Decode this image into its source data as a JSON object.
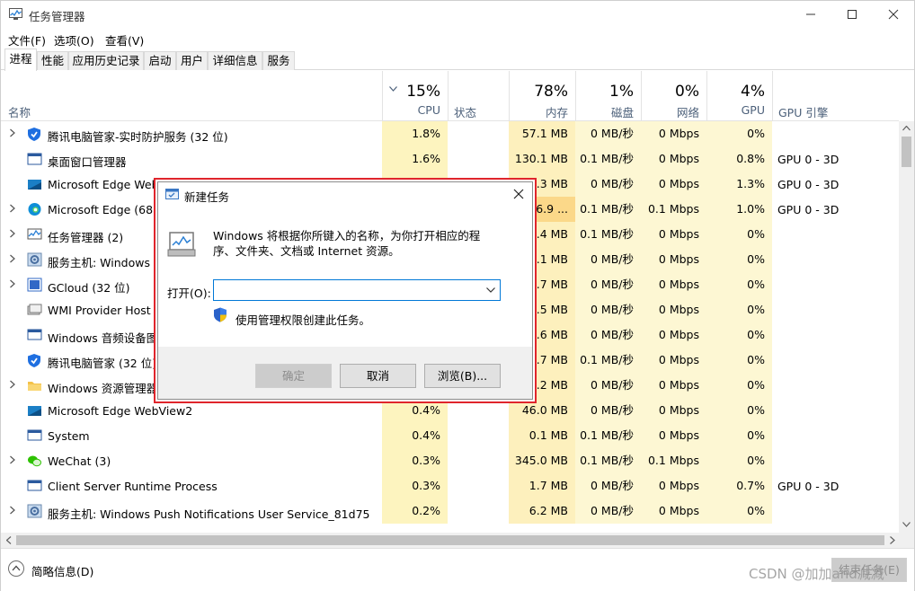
{
  "window": {
    "title": "任务管理器"
  },
  "menu": [
    "文件(F)",
    "选项(O)",
    "查看(V)"
  ],
  "tabs": [
    "进程",
    "性能",
    "应用历史记录",
    "启动",
    "用户",
    "详细信息",
    "服务"
  ],
  "columns": {
    "name": "名称",
    "cpu": {
      "pct": "15%",
      "label": "CPU"
    },
    "status": "状态",
    "memory": {
      "pct": "78%",
      "label": "内存"
    },
    "disk": {
      "pct": "1%",
      "label": "磁盘"
    },
    "network": {
      "pct": "0%",
      "label": "网络"
    },
    "gpu": {
      "pct": "4%",
      "label": "GPU"
    },
    "gpu_engine": "GPU 引擎"
  },
  "rows": [
    {
      "icon": "tencent-shield-icon",
      "name": "腾讯电脑管家-实时防护服务 (32 位)",
      "cpu": "1.8%",
      "mem": "57.1 MB",
      "disk": "0 MB/秒",
      "net": "0 Mbps",
      "gpu": "0%",
      "gpu_engine": ""
    },
    {
      "icon": "desktop-window-icon",
      "name": "桌面窗口管理器",
      "cpu": "1.6%",
      "mem": "130.1 MB",
      "disk": "0.1 MB/秒",
      "net": "0 Mbps",
      "gpu": "0.8%",
      "gpu_engine": "GPU 0 - 3D"
    },
    {
      "icon": "edge-webview-icon",
      "name": "Microsoft Edge WebView2",
      "cpu": "",
      "mem": "36.3 MB",
      "disk": "0 MB/秒",
      "net": "0 Mbps",
      "gpu": "1.3%",
      "gpu_engine": "GPU 0 - 3D"
    },
    {
      "icon": "edge-icon",
      "name": "Microsoft Edge (68)",
      "cpu": "",
      "mem": "1,036.9 ...",
      "disk": "0.1 MB/秒",
      "net": "0.1 Mbps",
      "gpu": "1.0%",
      "gpu_engine": "GPU 0 - 3D"
    },
    {
      "icon": "task-manager-icon",
      "name": "任务管理器 (2)",
      "cpu": "",
      "mem": "31.4 MB",
      "disk": "0.1 MB/秒",
      "net": "0 Mbps",
      "gpu": "0%",
      "gpu_engine": ""
    },
    {
      "icon": "service-host-icon",
      "name": "服务主机: Windows Management Instrumentation",
      "cpu": "",
      "mem": "12.1 MB",
      "disk": "0 MB/秒",
      "net": "0 Mbps",
      "gpu": "0%",
      "gpu_engine": ""
    },
    {
      "icon": "gcloud-icon",
      "name": "GCloud (32 位)",
      "cpu": "",
      "mem": "15.7 MB",
      "disk": "0 MB/秒",
      "net": "0 Mbps",
      "gpu": "0%",
      "gpu_engine": ""
    },
    {
      "icon": "wmi-icon",
      "name": "WMI Provider Host",
      "cpu": "",
      "mem": "3.5 MB",
      "disk": "0 MB/秒",
      "net": "0 Mbps",
      "gpu": "0%",
      "gpu_engine": ""
    },
    {
      "icon": "audio-graph-icon",
      "name": "Windows 音频设备图形隔离",
      "cpu": "",
      "mem": "8.6 MB",
      "disk": "0 MB/秒",
      "net": "0 Mbps",
      "gpu": "0%",
      "gpu_engine": ""
    },
    {
      "icon": "tencent-shield-icon",
      "name": "腾讯电脑管家 (32 位)",
      "cpu": "",
      "mem": "23.7 MB",
      "disk": "0.1 MB/秒",
      "net": "0 Mbps",
      "gpu": "0%",
      "gpu_engine": ""
    },
    {
      "icon": "explorer-folder-icon",
      "name": "Windows 资源管理器",
      "cpu": "",
      "mem": "70.2 MB",
      "disk": "0 MB/秒",
      "net": "0 Mbps",
      "gpu": "0%",
      "gpu_engine": ""
    },
    {
      "icon": "edge-webview-icon",
      "name": "Microsoft Edge WebView2",
      "cpu": "0.4%",
      "mem": "46.0 MB",
      "disk": "0 MB/秒",
      "net": "0 Mbps",
      "gpu": "0%",
      "gpu_engine": ""
    },
    {
      "icon": "system-icon",
      "name": "System",
      "cpu": "0.4%",
      "mem": "0.1 MB",
      "disk": "0.1 MB/秒",
      "net": "0 Mbps",
      "gpu": "0%",
      "gpu_engine": ""
    },
    {
      "icon": "wechat-icon",
      "name": "WeChat (3)",
      "cpu": "0.3%",
      "mem": "345.0 MB",
      "disk": "0.1 MB/秒",
      "net": "0.1 Mbps",
      "gpu": "0%",
      "gpu_engine": ""
    },
    {
      "icon": "csrss-icon",
      "name": "Client Server Runtime Process",
      "cpu": "0.3%",
      "mem": "1.7 MB",
      "disk": "0 MB/秒",
      "net": "0 Mbps",
      "gpu": "0.7%",
      "gpu_engine": "GPU 0 - 3D"
    },
    {
      "icon": "service-host-icon",
      "name": "服务主机: Windows Push Notifications User Service_81d75",
      "cpu": "0.2%",
      "mem": "6.2 MB",
      "disk": "0 MB/秒",
      "net": "0 Mbps",
      "gpu": "0%",
      "gpu_engine": ""
    }
  ],
  "footer": {
    "brief": "简略信息(D)",
    "end_task": "结束任务(E)"
  },
  "watermark": "CSDN @加加and减减",
  "dialog": {
    "title": "新建任务",
    "description": "Windows 将根据你所键入的名称，为你打开相应的程序、文件夹、文档或 Internet 资源。",
    "open_label": "打开(O):",
    "open_value": "",
    "admin_label": "使用管理权限创建此任务。",
    "ok": "确定",
    "cancel": "取消",
    "browse": "浏览(B)..."
  },
  "colors": {
    "cpu_col": "#fdf4bf",
    "mem_hot": "#fbd889",
    "dialog_border": "#e0252c"
  }
}
